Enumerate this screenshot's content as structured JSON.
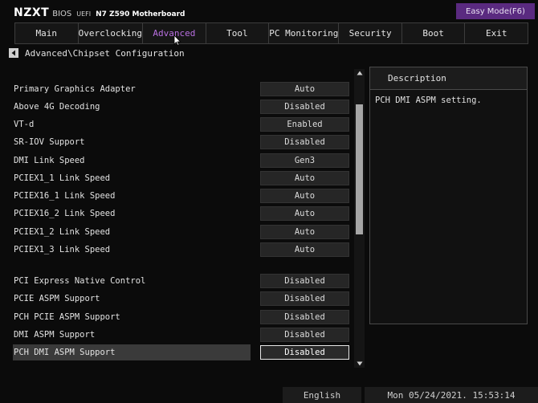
{
  "header": {
    "logo": "NZXT",
    "bios": "BIOS",
    "uefi": "UEFI",
    "model": "N7 Z590 Motherboard",
    "easy_mode_label": "Easy Mode(F6)"
  },
  "tabs": [
    {
      "label": "Main"
    },
    {
      "label": "Overclocking"
    },
    {
      "label": "Advanced"
    },
    {
      "label": "Tool"
    },
    {
      "label": "PC Monitoring"
    },
    {
      "label": "Security"
    },
    {
      "label": "Boot"
    },
    {
      "label": "Exit"
    }
  ],
  "active_tab": "Advanced",
  "breadcrumb": "Advanced\\Chipset Configuration",
  "settings": [
    {
      "label": "Primary Graphics Adapter",
      "value": "Auto"
    },
    {
      "label": "Above 4G Decoding",
      "value": "Disabled"
    },
    {
      "label": "VT-d",
      "value": "Enabled"
    },
    {
      "label": "SR-IOV Support",
      "value": "Disabled"
    },
    {
      "label": "DMI Link Speed",
      "value": "Gen3"
    },
    {
      "label": "PCIEX1_1 Link Speed",
      "value": "Auto"
    },
    {
      "label": "PCIEX16_1 Link Speed",
      "value": "Auto"
    },
    {
      "label": "PCIEX16_2 Link Speed",
      "value": "Auto"
    },
    {
      "label": "PCIEX1_2 Link Speed",
      "value": "Auto"
    },
    {
      "label": "PCIEX1_3 Link Speed",
      "value": "Auto"
    },
    {
      "label": "PCI Express Native Control",
      "value": "Disabled"
    },
    {
      "label": "PCIE ASPM Support",
      "value": "Disabled"
    },
    {
      "label": "PCH PCIE ASPM Support",
      "value": "Disabled"
    },
    {
      "label": "DMI ASPM Support",
      "value": "Disabled"
    },
    {
      "label": "PCH DMI ASPM Support",
      "value": "Disabled"
    }
  ],
  "selected_setting": "PCH DMI ASPM Support",
  "description": {
    "title": "Description",
    "text": "PCH DMI ASPM setting."
  },
  "footer": {
    "language": "English",
    "datetime": "Mon 05/24/2021. 15:53:14"
  },
  "colors": {
    "accent": "#b86fe0",
    "easy_mode_bg": "#5a2a80",
    "background": "#0b0b0b"
  }
}
